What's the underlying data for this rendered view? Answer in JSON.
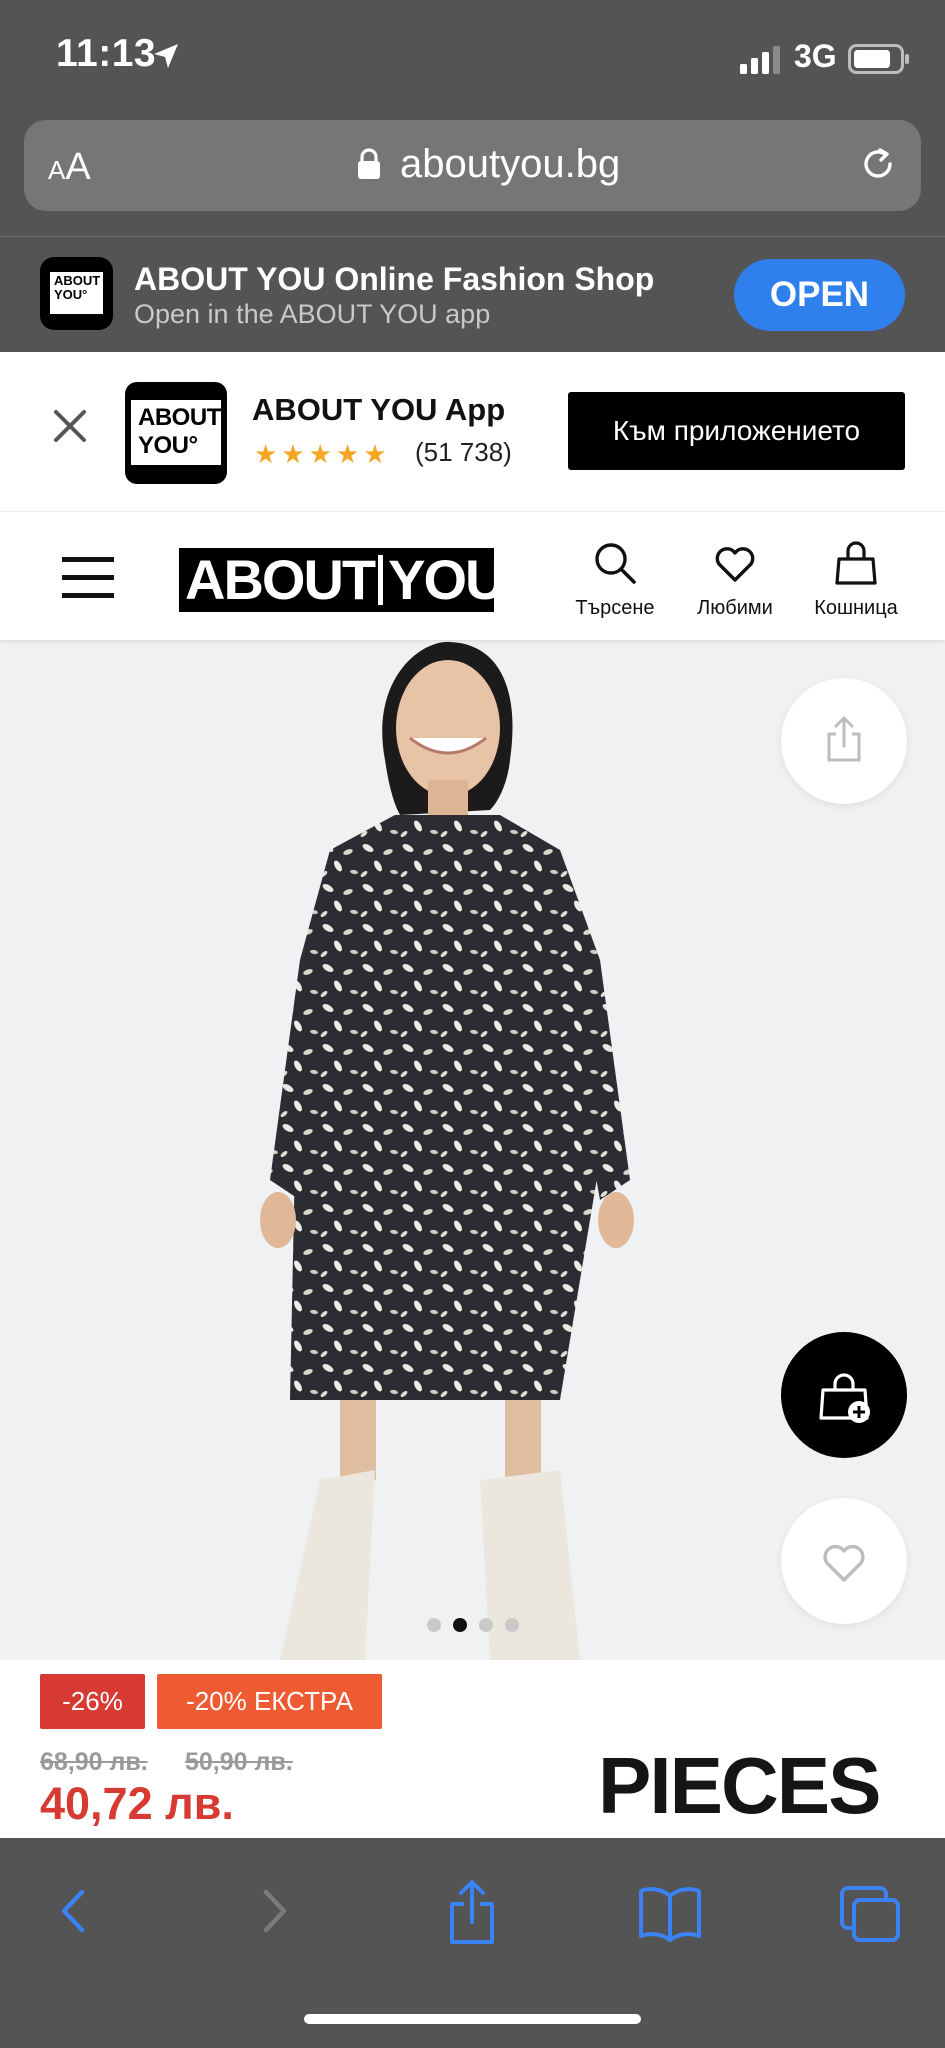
{
  "status_bar": {
    "time": "11:13",
    "network": "3G"
  },
  "browser": {
    "text_size": "AA",
    "url": "aboutyou.bg"
  },
  "smart_banner": {
    "title": "ABOUT YOU Online Fashion Shop",
    "subtitle": "Open in the ABOUT YOU app",
    "open_label": "OPEN",
    "logo_line1": "ABOUT",
    "logo_line2": "YOU°"
  },
  "app_promo": {
    "title": "ABOUT YOU App",
    "stars": "★★★★★",
    "rating": 4.5,
    "rating_count": "(51 738)",
    "cta": "Към приложението",
    "logo_line1": "ABOUT",
    "logo_line2": "YOU°"
  },
  "header": {
    "logo_left": "ABOUT",
    "logo_right": "YOU°",
    "search_label": "Търсене",
    "favorites_label": "Любими",
    "cart_label": "Кошница"
  },
  "gallery": {
    "image_count": 4,
    "active_index": 1
  },
  "price": {
    "discount_badge": "-26%",
    "extra_badge": "-20% ЕКСТРА",
    "old_price_1": "68,90 лв.",
    "old_price_2": "50,90 лв.",
    "current_price": "40,72 лв."
  },
  "brand": "PIECES",
  "colors": {
    "accent_blue": "#2f80ed",
    "sale_red": "#d63a33",
    "extra_orange": "#ee5b33",
    "chrome_gray": "#545454",
    "rating_star": "#f5a623"
  }
}
